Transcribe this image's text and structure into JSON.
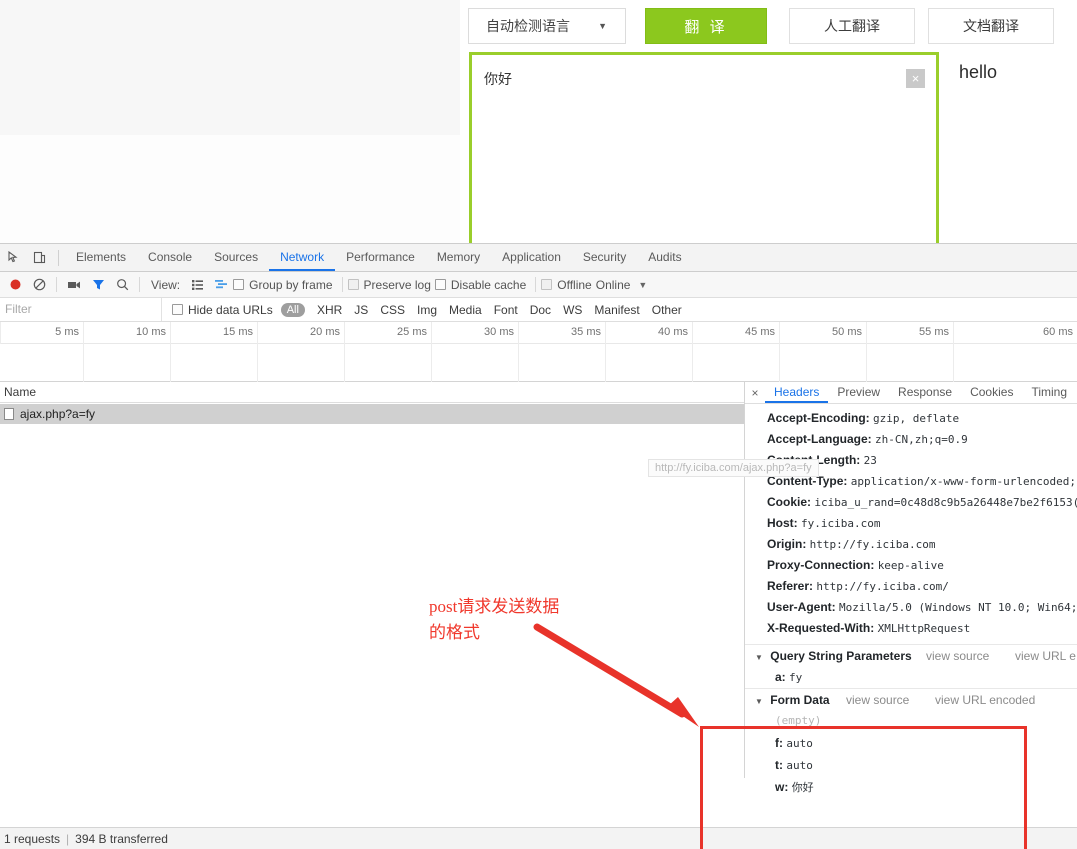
{
  "page": {
    "lang_select": "自动检测语言",
    "caret_icon": "chevron-down-icon",
    "translate_button": "翻 译",
    "human_translate_button": "人工翻译",
    "doc_translate_button": "文档翻译",
    "source_text": "你好",
    "clear_icon": "×",
    "result_text": "hello",
    "accent_color": "#8cc81e",
    "input_border_color": "#9ace2b"
  },
  "devtools": {
    "main_tabs": [
      {
        "label": "Elements",
        "active": false
      },
      {
        "label": "Console",
        "active": false
      },
      {
        "label": "Sources",
        "active": false
      },
      {
        "label": "Network",
        "active": true
      },
      {
        "label": "Performance",
        "active": false
      },
      {
        "label": "Memory",
        "active": false
      },
      {
        "label": "Application",
        "active": false
      },
      {
        "label": "Security",
        "active": false
      },
      {
        "label": "Audits",
        "active": false
      }
    ],
    "toolbar": {
      "record_icon": "record-icon",
      "clear_icon": "clear-icon",
      "camera_icon": "camera-icon",
      "filter_icon": "funnel-icon",
      "search_icon": "search-icon",
      "view_label": "View:",
      "list_view_icon": "list-view-icon",
      "waterfall_view_icon": "waterfall-view-icon",
      "group_by_frame": "Group by frame",
      "preserve_log": "Preserve log",
      "disable_cache": "Disable cache",
      "offline": "Offline",
      "throttle": "Online",
      "throttle_caret_icon": "chevron-down-icon"
    },
    "filter": {
      "placeholder": "Filter",
      "hide_data_urls": "Hide data URLs",
      "types": [
        "All",
        "XHR",
        "JS",
        "CSS",
        "Img",
        "Media",
        "Font",
        "Doc",
        "WS",
        "Manifest",
        "Other"
      ]
    },
    "timeline": {
      "ticks": [
        "5 ms",
        "10 ms",
        "15 ms",
        "20 ms",
        "25 ms",
        "30 ms",
        "35 ms",
        "40 ms",
        "45 ms",
        "50 ms",
        "55 ms",
        "60 ms"
      ],
      "bar_color": "#0fb04a"
    },
    "table": {
      "column_header": "Name",
      "rows": [
        {
          "name": "ajax.php?a=fy",
          "icon": "document-icon"
        }
      ],
      "tooltip": "http://fy.iciba.com/ajax.php?a=fy"
    },
    "details": {
      "close_icon": "×",
      "tabs": [
        {
          "label": "Headers",
          "active": true
        },
        {
          "label": "Preview",
          "active": false
        },
        {
          "label": "Response",
          "active": false
        },
        {
          "label": "Cookies",
          "active": false
        },
        {
          "label": "Timing",
          "active": false
        }
      ],
      "request_headers": [
        {
          "key": "Accept-Encoding:",
          "value": "gzip, deflate"
        },
        {
          "key": "Accept-Language:",
          "value": "zh-CN,zh;q=0.9"
        },
        {
          "key": "Content-Length:",
          "value": "23"
        },
        {
          "key": "Content-Type:",
          "value": "application/x-www-form-urlencoded;"
        },
        {
          "key": "Cookie:",
          "value": "iciba_u_rand=0c48d8c9b5a26448e7be2f6153("
        },
        {
          "key": "Host:",
          "value": "fy.iciba.com"
        },
        {
          "key": "Origin:",
          "value": "http://fy.iciba.com"
        },
        {
          "key": "Proxy-Connection:",
          "value": "keep-alive"
        },
        {
          "key": "Referer:",
          "value": "http://fy.iciba.com/"
        },
        {
          "key": "User-Agent:",
          "value": "Mozilla/5.0 (Windows NT 10.0; Win64;"
        },
        {
          "key": "X-Requested-With:",
          "value": "XMLHttpRequest"
        }
      ],
      "query_section": {
        "title": "Query String Parameters",
        "triangle_icon": "triangle-down-icon",
        "view_source": "view source",
        "view_url_encoded": "view URL e",
        "params": [
          {
            "key": "a:",
            "value": "fy"
          }
        ]
      },
      "form_section": {
        "title": "Form Data",
        "triangle_icon": "triangle-down-icon",
        "view_source": "view source",
        "view_url_encoded": "view URL encoded",
        "empty_label": "(empty)",
        "params": [
          {
            "key": "f:",
            "value": "auto"
          },
          {
            "key": "t:",
            "value": "auto"
          },
          {
            "key": "w:",
            "value": "你好"
          }
        ]
      }
    },
    "status": {
      "requests": "1 requests",
      "separator": "|",
      "transferred": "394 B transferred"
    }
  },
  "annotation": {
    "text": "post请求发送数据\n的格式",
    "color": "#f0382c",
    "box_color": "#e8332a"
  }
}
